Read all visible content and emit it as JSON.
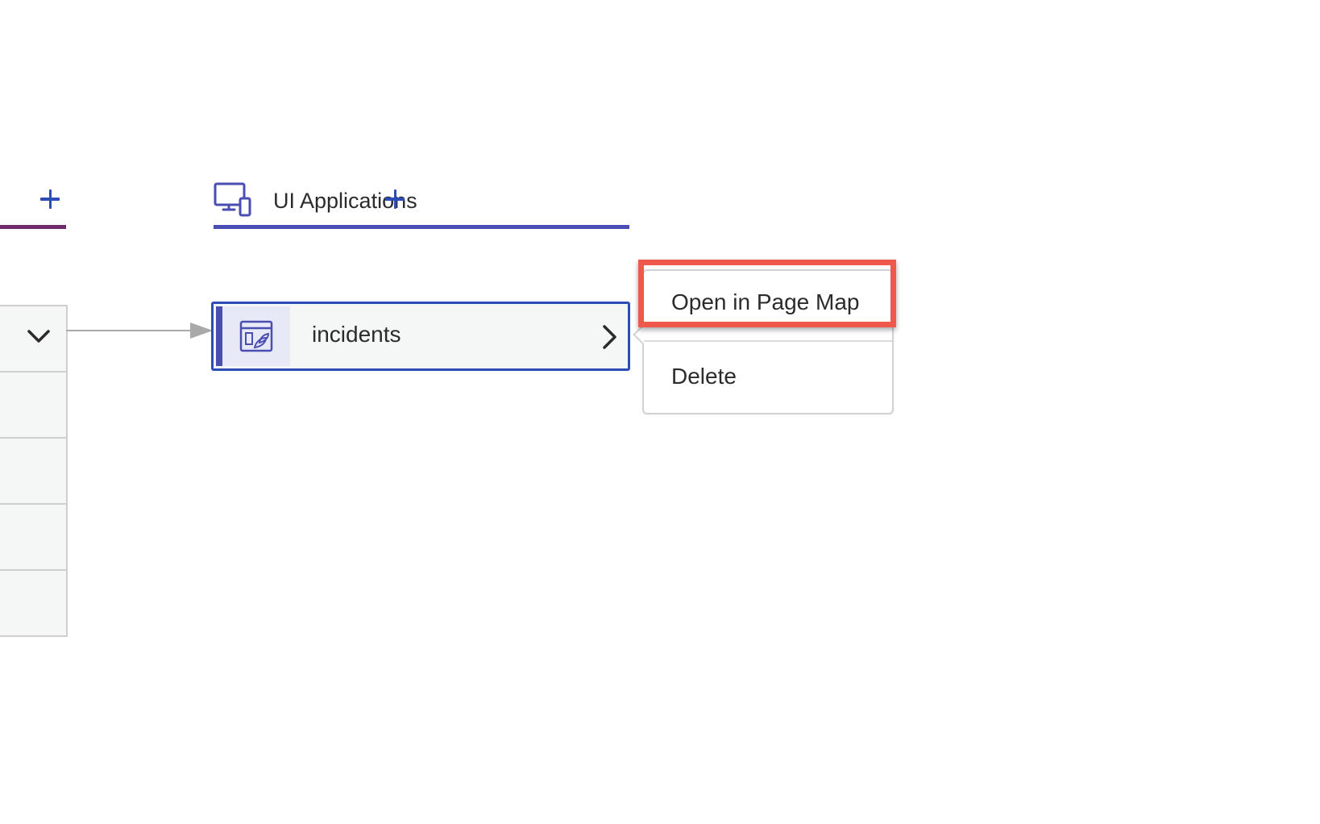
{
  "previous_column": {
    "add_button_icon": "plus-icon",
    "accent_color": "#6e2a6a",
    "row_count": 5,
    "expand_icon": "chevron-down-icon"
  },
  "ui_applications_column": {
    "title": "UI Applications",
    "header_icon": "devices-icon",
    "add_button_icon": "plus-icon",
    "accent_color": "#4a4db2",
    "items": [
      {
        "label": "incidents",
        "icon": "app-window-icon",
        "expand_icon": "chevron-right-icon",
        "selected": true
      }
    ]
  },
  "context_menu": {
    "items": [
      {
        "label": "Open in Page Map",
        "highlighted": true
      },
      {
        "label": "Delete"
      }
    ]
  },
  "colors": {
    "brand_blue": "#2d4db6",
    "highlight_red": "#f0574d"
  }
}
